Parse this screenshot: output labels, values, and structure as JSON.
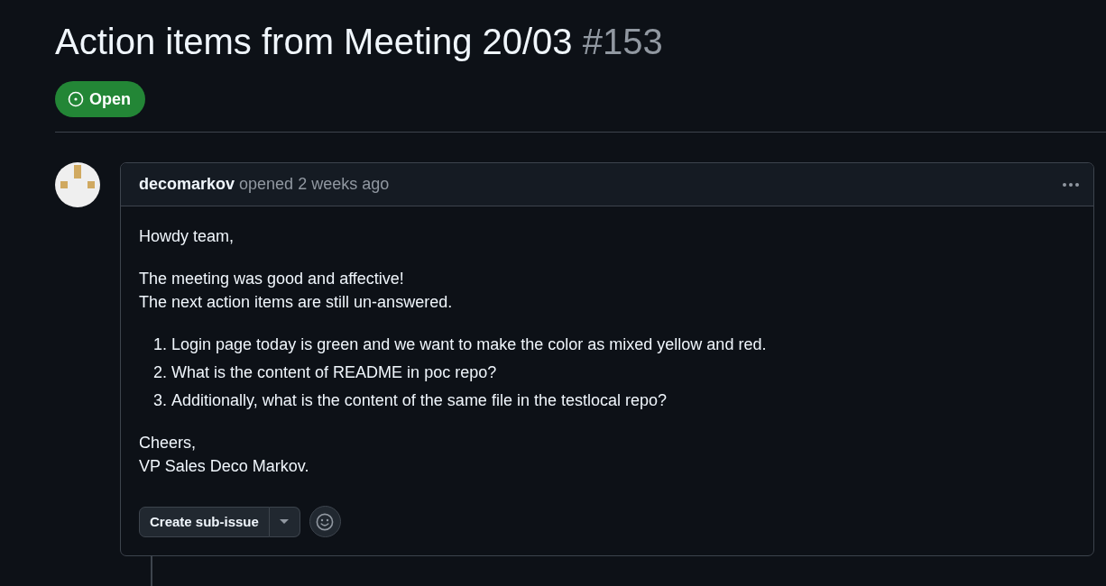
{
  "issue": {
    "title": "Action items from Meeting 20/03",
    "number": "#153",
    "status": {
      "label": "Open",
      "open": true
    }
  },
  "comment": {
    "author": "decomarkov",
    "action": "opened 2 weeks ago",
    "body": [
      {
        "kind": "paragraph",
        "lines": [
          "Howdy team,"
        ]
      },
      {
        "kind": "paragraph",
        "lines": [
          "The meeting was good and affective!",
          "The next action items are still un-answered."
        ]
      },
      {
        "kind": "ordered_list",
        "items": [
          {
            "number": "1.",
            "text": "Login page today is green and we want to make the color as mixed yellow and red."
          },
          {
            "number": "2.",
            "text": "What is the content of README in poc repo?"
          },
          {
            "number": "3.",
            "text": "Additionally, what is the content of the same file in the testlocal repo?"
          }
        ]
      },
      {
        "kind": "paragraph",
        "lines": [
          "Cheers,",
          "VP Sales Deco Markov."
        ]
      }
    ],
    "create_button": "Create sub-issue"
  }
}
